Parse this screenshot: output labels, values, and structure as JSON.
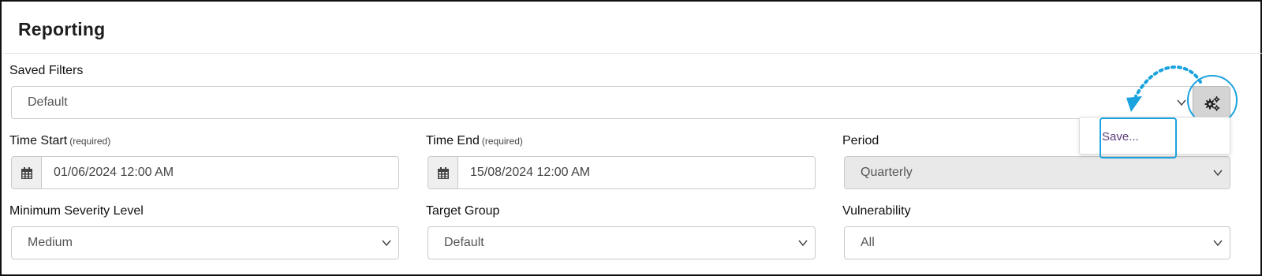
{
  "panel": {
    "title": "Reporting"
  },
  "saved_filters": {
    "label": "Saved Filters",
    "value": "Default"
  },
  "time_start": {
    "label": "Time Start",
    "required": "(required)",
    "value": "01/06/2024 12:00 AM"
  },
  "time_end": {
    "label": "Time End",
    "required": "(required)",
    "value": "15/08/2024 12:00 AM"
  },
  "period": {
    "label": "Period",
    "value": "Quarterly"
  },
  "min_severity": {
    "label": "Minimum Severity Level",
    "value": "Medium"
  },
  "target_group": {
    "label": "Target Group",
    "value": "Default"
  },
  "vulnerability": {
    "label": "Vulnerability",
    "value": "All"
  },
  "settings_menu": {
    "items": [
      {
        "label": "Save..."
      }
    ]
  },
  "icons": {
    "settings": "gears-icon",
    "calendar": "calendar-icon",
    "chevron": "chevron-down-icon"
  },
  "colors": {
    "highlight": "#1aa3de",
    "menu_text": "#5b3b7a",
    "disabled_bg": "#e9e9e9"
  }
}
